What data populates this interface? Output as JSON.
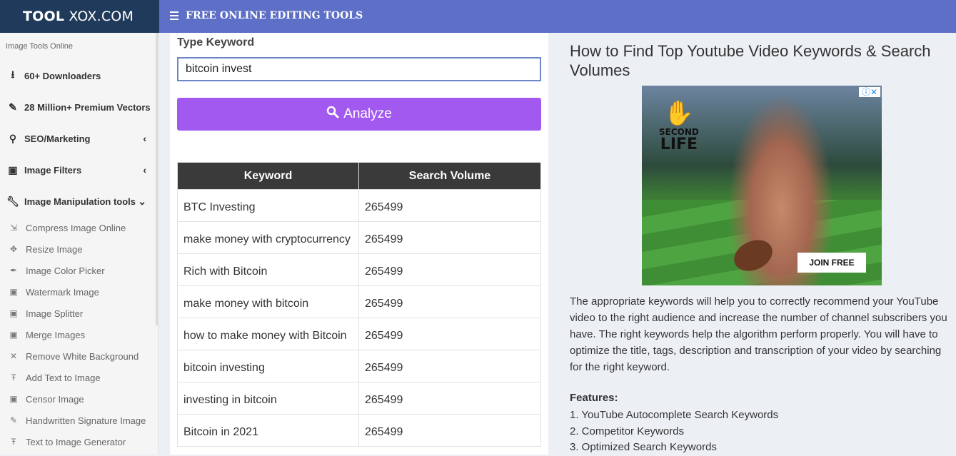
{
  "header": {
    "logo_bold": "TOOL",
    "logo_rest": "XOX.COM",
    "title": "FREE ONLINE EDITING TOOLS",
    "menu_icon": "hamburger-icon"
  },
  "sidebar": {
    "heading": "Image Tools Online",
    "items": [
      {
        "label": "60+ Downloaders",
        "icon": "download-icon"
      },
      {
        "label": "28 Million+ Premium Vectors",
        "icon": "pencil-icon"
      },
      {
        "label": "SEO/Marketing",
        "icon": "search-icon",
        "chevron": "‹"
      },
      {
        "label": "Image Filters",
        "icon": "image-icon",
        "chevron": "‹"
      },
      {
        "label": "Image Manipulation tools",
        "icon": "wrench-icon",
        "chevron": "⌄"
      }
    ],
    "subitems": [
      {
        "label": "Compress Image Online",
        "icon": "compress-icon"
      },
      {
        "label": "Resize Image",
        "icon": "move-icon"
      },
      {
        "label": "Image Color Picker",
        "icon": "eyedropper-icon"
      },
      {
        "label": "Watermark Image",
        "icon": "image-icon"
      },
      {
        "label": "Image Splitter",
        "icon": "image-icon"
      },
      {
        "label": "Merge Images",
        "icon": "image-icon"
      },
      {
        "label": "Remove White Background",
        "icon": "close-icon"
      },
      {
        "label": "Add Text to Image",
        "icon": "text-icon"
      },
      {
        "label": "Censor Image",
        "icon": "image-icon"
      },
      {
        "label": "Handwritten Signature Image",
        "icon": "pencil-icon"
      },
      {
        "label": "Text to Image Generator",
        "icon": "text-icon"
      }
    ]
  },
  "form": {
    "label": "Type Keyword",
    "value": "bitcoin invest",
    "button_label": "Analyze"
  },
  "table": {
    "headers": [
      "Keyword",
      "Search Volume"
    ],
    "rows": [
      [
        "BTC Investing",
        "265499"
      ],
      [
        "make money with cryptocurrency",
        "265499"
      ],
      [
        "Rich with Bitcoin",
        "265499"
      ],
      [
        "make money with bitcoin",
        "265499"
      ],
      [
        "how to make money with Bitcoin",
        "265499"
      ],
      [
        "bitcoin investing",
        "265499"
      ],
      [
        "investing in bitcoin",
        "265499"
      ],
      [
        "Bitcoin in 2021",
        "265499"
      ]
    ]
  },
  "article": {
    "title": "How to Find Top Youtube Video Keywords & Search Volumes",
    "description": "The appropriate keywords will help you to correctly recommend your YouTube video to the right audience and increase the number of channel subscribers you have. The right keywords help the algorithm perform properly. You will have to optimize the title, tags, description and transcription of your video by searching for the right keyword.",
    "features_heading": "Features:",
    "features": [
      "1. YouTube Autocomplete Search Keywords",
      "2. Competitor Keywords",
      "3. Optimized Search Keywords"
    ]
  },
  "ad": {
    "brand_top": "SECOND",
    "brand_bottom": "LIFE",
    "cta": "JOIN FREE",
    "close_icon": "ⓘ✕"
  },
  "colors": {
    "header_bg": "#5e6fc7",
    "logo_bg": "#1f3a5a",
    "button_bg": "#a259f0",
    "table_header_bg": "#3a3a3a"
  }
}
